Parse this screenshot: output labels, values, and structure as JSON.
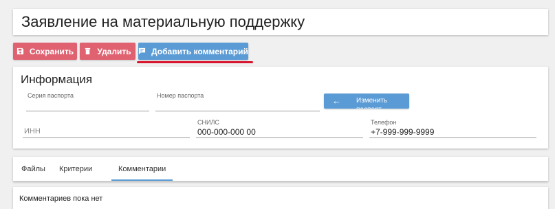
{
  "page": {
    "title": "Заявление на материальную поддержку"
  },
  "toolbar": {
    "save_label": "Сохранить",
    "delete_label": "Удалить",
    "add_comment_label": "Добавить комментарий",
    "accent_danger": "#e06271",
    "accent_primary": "#5b9bd5",
    "highlight_color": "#d8152e"
  },
  "info": {
    "title": "Информация",
    "passport_series_label": "Серия паспорта",
    "passport_number_label": "Номер паспорта",
    "change_passport_label": "Изменить паспорт",
    "inn_placeholder": "ИНН",
    "snils_label": "СНИЛС",
    "snils_value": "000-000-000 00",
    "phone_label": "Телефон",
    "phone_value": "+7-999-999-9999"
  },
  "tabs": [
    {
      "label": "Файлы",
      "active": false
    },
    {
      "label": "Критерии",
      "active": false
    },
    {
      "label": "Комментарии",
      "active": true
    }
  ],
  "comments": {
    "empty_text": "Комментариев пока нет"
  },
  "icons": {
    "save": "save-icon",
    "delete": "trash-icon",
    "comment": "comment-icon",
    "back": "arrow-left-icon"
  }
}
